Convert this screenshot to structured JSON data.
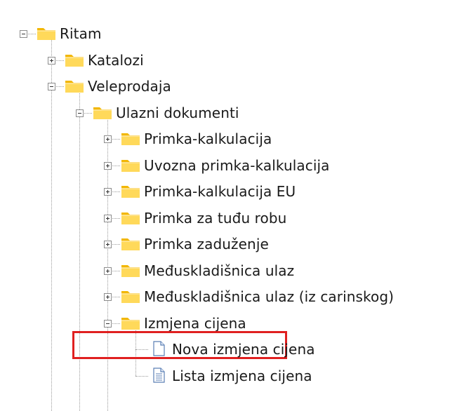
{
  "tree": {
    "nodes": [
      {
        "label": "Ritam",
        "level": 0,
        "state": "expanded",
        "icon": "folder-icon"
      },
      {
        "label": "Katalozi",
        "level": 1,
        "state": "collapsed",
        "icon": "folder-icon"
      },
      {
        "label": "Veleprodaja",
        "level": 1,
        "state": "expanded",
        "icon": "folder-icon"
      },
      {
        "label": "Ulazni dokumenti",
        "level": 2,
        "state": "expanded",
        "icon": "folder-icon"
      },
      {
        "label": "Primka-kalkulacija",
        "level": 3,
        "state": "collapsed",
        "icon": "folder-icon"
      },
      {
        "label": "Uvozna primka-kalkulacija",
        "level": 3,
        "state": "collapsed",
        "icon": "folder-icon"
      },
      {
        "label": "Primka-kalkulacija EU",
        "level": 3,
        "state": "collapsed",
        "icon": "folder-icon"
      },
      {
        "label": "Primka za tuđu robu",
        "level": 3,
        "state": "collapsed",
        "icon": "folder-icon"
      },
      {
        "label": "Primka zaduženje",
        "level": 3,
        "state": "collapsed",
        "icon": "folder-icon"
      },
      {
        "label": "Međuskladišnica ulaz",
        "level": 3,
        "state": "collapsed",
        "icon": "folder-icon"
      },
      {
        "label": "Međuskladišnica ulaz (iz carinskog)",
        "level": 3,
        "state": "collapsed",
        "icon": "folder-icon"
      },
      {
        "label": "Izmjena cijena",
        "level": 3,
        "state": "expanded",
        "icon": "folder-icon",
        "highlighted": true
      },
      {
        "label": "Nova izmjena cijena",
        "level": 4,
        "state": "leaf",
        "icon": "new-document-icon"
      },
      {
        "label": "Lista izmjena cijena",
        "level": 4,
        "state": "leaf",
        "icon": "list-document-icon"
      }
    ]
  },
  "colors": {
    "folder_light": "#FFD95A",
    "folder_dark": "#F2B705",
    "highlight": "#E02020",
    "tree_line": "#9A9A9A"
  }
}
